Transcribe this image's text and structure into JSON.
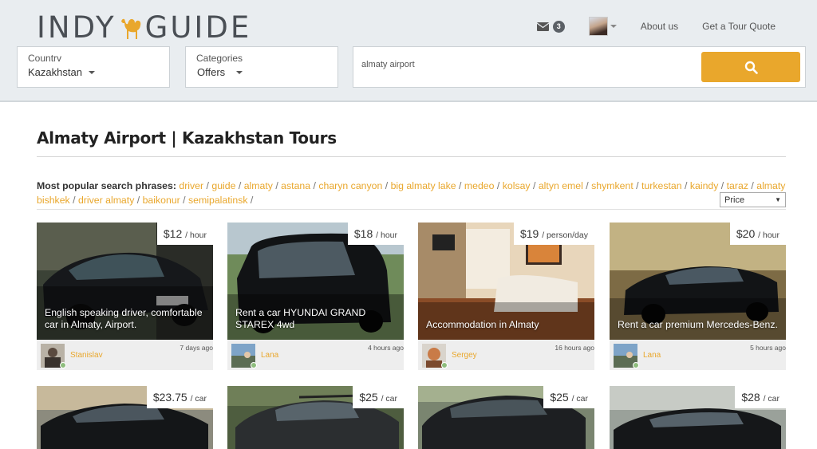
{
  "header": {
    "logo_left": "INDY",
    "logo_right": "GUIDE",
    "mail_count": "3",
    "about_label": "About us",
    "quote_label": "Get a Tour Quote",
    "country_label": "Countrv",
    "country_value": "Kazakhstan",
    "category_label": "Categories",
    "category_value": "Offers",
    "search_value": "almaty airport",
    "accent_color": "#e9a72c"
  },
  "main": {
    "title": "Almaty Airport | Kazakhstan Tours",
    "popular_lead": "Most popular search phrases:",
    "phrases": [
      "driver",
      "guide",
      "almaty",
      "astana",
      "charyn canyon",
      "big almaty lake",
      "medeo",
      "kolsay",
      "altyn emel",
      "shymkent",
      "turkestan",
      "kaindy",
      "taraz",
      "almaty bishkek",
      "driver almaty",
      "baikonur",
      "semipalatinsk"
    ],
    "sort_value": "Price"
  },
  "cards": [
    {
      "price": "$12",
      "unit": "/ hour",
      "caption": "English speaking driver, comfortable car in Almaty, Airport.",
      "user": "Stanislav",
      "time": "7 days ago"
    },
    {
      "price": "$18",
      "unit": "/ hour",
      "caption": "Rent a car HYUNDAI GRAND STAREX 4wd",
      "user": "Lana",
      "time": "4 hours ago"
    },
    {
      "price": "$19",
      "unit": "/ person/day",
      "caption": "Accommodation in Almaty",
      "user": "Sergey",
      "time": "16 hours ago"
    },
    {
      "price": "$20",
      "unit": "/ hour",
      "caption": "Rent a car premium Mercedes-Benz.",
      "user": "Lana",
      "time": "5 hours ago"
    },
    {
      "price": "$23.75",
      "unit": "/ car"
    },
    {
      "price": "$25",
      "unit": "/ car"
    },
    {
      "price": "$25",
      "unit": "/ car"
    },
    {
      "price": "$28",
      "unit": "/ car"
    }
  ]
}
